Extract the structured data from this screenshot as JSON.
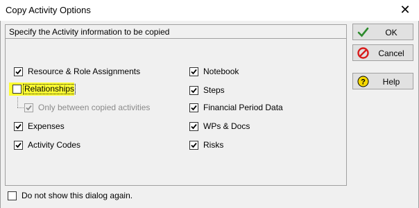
{
  "window": {
    "title": "Copy Activity Options",
    "close_icon": "close-icon"
  },
  "panel": {
    "header": "Specify the Activity information to be copied"
  },
  "options_left": [
    {
      "label": "Resource & Role Assignments",
      "checked": true
    },
    {
      "label": "Relationships",
      "checked": false,
      "highlighted": true
    },
    {
      "label": "Only between copied activities",
      "checked": true,
      "disabled": true
    },
    {
      "label": "Expenses",
      "checked": true
    },
    {
      "label": "Activity Codes",
      "checked": true
    }
  ],
  "options_right": [
    {
      "label": "Notebook",
      "checked": true
    },
    {
      "label": "Steps",
      "checked": true
    },
    {
      "label": "Financial Period Data",
      "checked": true
    },
    {
      "label": "WPs & Docs",
      "checked": true
    },
    {
      "label": "Risks",
      "checked": true
    }
  ],
  "buttons": {
    "ok": {
      "label": "OK",
      "icon": "checkmark-icon",
      "color": "#2e8b2e"
    },
    "cancel": {
      "label": "Cancel",
      "icon": "cancel-icon",
      "color": "#d81b1b"
    },
    "help": {
      "label": "Help",
      "icon": "help-icon",
      "color": "#f5d800"
    }
  },
  "footer": {
    "label": "Do not show this dialog again.",
    "checked": false
  },
  "colors": {
    "highlight": "#ffff33",
    "background": "#f0f0f0"
  }
}
